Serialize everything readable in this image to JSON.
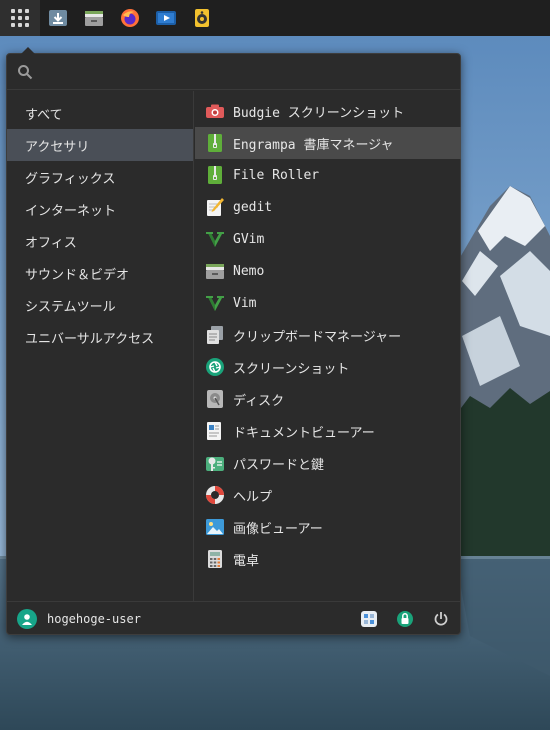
{
  "search": {
    "placeholder": "",
    "value": ""
  },
  "panel": {
    "launchers": [
      {
        "icon": "app-grid-icon"
      },
      {
        "icon": "download-icon"
      },
      {
        "icon": "nemo-icon"
      },
      {
        "icon": "firefox-icon"
      },
      {
        "icon": "media-player-icon"
      },
      {
        "icon": "speaker-icon"
      }
    ]
  },
  "categories": [
    {
      "label": "すべて",
      "active": false
    },
    {
      "label": "アクセサリ",
      "active": true
    },
    {
      "label": "グラフィックス",
      "active": false
    },
    {
      "label": "インターネット",
      "active": false
    },
    {
      "label": "オフィス",
      "active": false
    },
    {
      "label": "サウンド＆ビデオ",
      "active": false
    },
    {
      "label": "システムツール",
      "active": false
    },
    {
      "label": "ユニバーサルアクセス",
      "active": false
    }
  ],
  "apps": [
    {
      "label": "Budgie スクリーンショット",
      "icon": "camera-icon",
      "active": false
    },
    {
      "label": "Engrampa 書庫マネージャ",
      "icon": "archive-icon",
      "active": true
    },
    {
      "label": "File Roller",
      "icon": "archive-icon",
      "active": false
    },
    {
      "label": "gedit",
      "icon": "text-editor-icon",
      "active": false
    },
    {
      "label": "GVim",
      "icon": "vim-icon",
      "active": false
    },
    {
      "label": "Nemo",
      "icon": "file-manager-icon",
      "active": false
    },
    {
      "label": "Vim",
      "icon": "vim-icon",
      "active": false
    },
    {
      "label": "クリップボードマネージャー",
      "icon": "clipboard-icon",
      "active": false
    },
    {
      "label": "スクリーンショット",
      "icon": "screenshot-icon",
      "active": false
    },
    {
      "label": "ディスク",
      "icon": "disk-icon",
      "active": false
    },
    {
      "label": "ドキュメントビューアー",
      "icon": "document-viewer-icon",
      "active": false
    },
    {
      "label": "パスワードと鍵",
      "icon": "keys-icon",
      "active": false
    },
    {
      "label": "ヘルプ",
      "icon": "help-lifebuoy-icon",
      "active": false
    },
    {
      "label": "画像ビューアー",
      "icon": "image-viewer-icon",
      "active": false
    },
    {
      "label": "電卓",
      "icon": "calculator-icon",
      "active": false
    }
  ],
  "footer": {
    "username": "hogehoge-user",
    "buttons": [
      {
        "icon": "settings-icon"
      },
      {
        "icon": "lock-icon"
      },
      {
        "icon": "power-icon"
      }
    ]
  },
  "colors": {
    "panel_bg": "#1f1f1f",
    "menu_bg": "#2b2b2b",
    "active_category": "#4a4f57",
    "active_app": "#4a4a4a",
    "accent_green": "#17a589"
  }
}
